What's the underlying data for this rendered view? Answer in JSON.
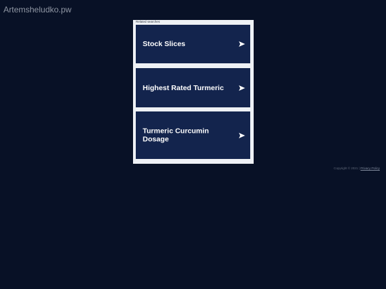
{
  "site": {
    "title": "Artemsheludko.pw"
  },
  "related": {
    "heading": "Related searches",
    "items": [
      {
        "label": "Stock Slices",
        "icon": "arrow-right-icon"
      },
      {
        "label": "Highest Rated Turmeric",
        "icon": "arrow-right-icon"
      },
      {
        "label": "Turmeric Curcumin Dosage",
        "icon": "arrow-right-icon"
      }
    ]
  },
  "footer": {
    "copyright": "Copyright © 2021 |",
    "privacy_label": "Privacy Policy"
  },
  "colors": {
    "background": "#081126",
    "panel": "#eef1f5",
    "result_background": "#13244d",
    "result_text": "#ffffff"
  }
}
